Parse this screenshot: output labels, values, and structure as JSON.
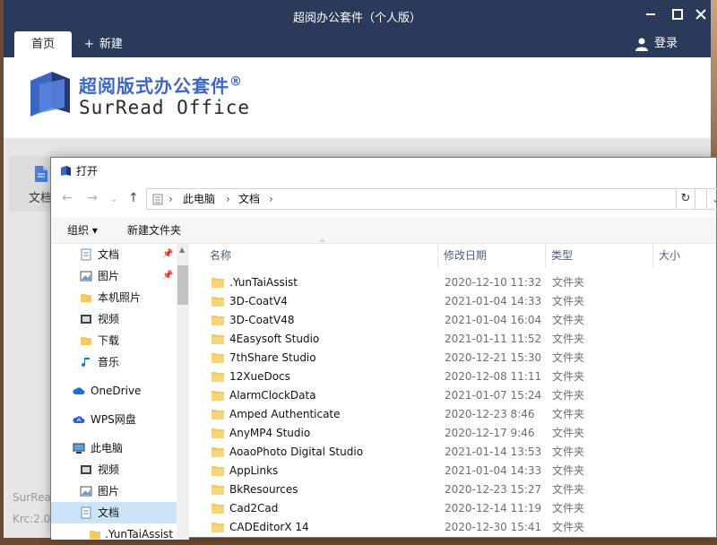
{
  "app": {
    "title": "超阅办公套件（个人版）",
    "tabs": {
      "home": "首页",
      "new": "新建"
    },
    "login": "登录",
    "brand_cn": "超阅版式办公套件",
    "brand_reg": "®",
    "brand_en": "SurRead  Office",
    "side_item": "文档",
    "footer_1": "SurRea",
    "footer_2": "Krc:2.0"
  },
  "window_controls": {
    "minimize": "✕",
    "restore": "—",
    "maximize": "☐",
    "close": "✕"
  },
  "dialog": {
    "title": "打开",
    "address": [
      "此电脑",
      "文档"
    ],
    "toolbar": {
      "organize": "组织 ▾",
      "new_folder": "新建文件夹"
    },
    "nav_items": [
      {
        "label": "文档",
        "icon": "document-icon",
        "pinned": true
      },
      {
        "label": "图片",
        "icon": "pictures-icon",
        "pinned": true
      },
      {
        "label": "本机照片",
        "icon": "folder-icon",
        "pinned": false
      },
      {
        "label": "视频",
        "icon": "video-icon",
        "pinned": false
      },
      {
        "label": "下载",
        "icon": "folder-icon",
        "pinned": false
      },
      {
        "label": "音乐",
        "icon": "music-icon",
        "pinned": false
      },
      {
        "label": "OneDrive",
        "icon": "cloud-icon",
        "pinned": false
      },
      {
        "label": "WPS网盘",
        "icon": "wps-cloud-icon",
        "pinned": false
      },
      {
        "label": "此电脑",
        "icon": "computer-icon",
        "pinned": false
      },
      {
        "label": "视频",
        "icon": "video-icon",
        "pinned": false
      },
      {
        "label": "图片",
        "icon": "pictures-icon",
        "pinned": false
      },
      {
        "label": "文档",
        "icon": "document-icon",
        "pinned": false
      },
      {
        "label": ".YunTaiAssist",
        "icon": "folder-icon",
        "pinned": false
      }
    ],
    "columns": {
      "name": "名称",
      "date": "修改日期",
      "type": "类型",
      "size": "大小"
    },
    "files": [
      {
        "name": ".YunTaiAssist",
        "date": "2020-12-10 11:32",
        "type": "文件夹"
      },
      {
        "name": "3D-CoatV4",
        "date": "2021-01-04 14:33",
        "type": "文件夹"
      },
      {
        "name": "3D-CoatV48",
        "date": "2021-01-04 16:04",
        "type": "文件夹"
      },
      {
        "name": "4Easysoft Studio",
        "date": "2021-01-11 11:52",
        "type": "文件夹"
      },
      {
        "name": "7thShare Studio",
        "date": "2020-12-21 15:30",
        "type": "文件夹"
      },
      {
        "name": "12XueDocs",
        "date": "2020-12-08 11:11",
        "type": "文件夹"
      },
      {
        "name": "AlarmClockData",
        "date": "2021-01-07 15:24",
        "type": "文件夹"
      },
      {
        "name": "Amped Authenticate",
        "date": "2020-12-23 8:46",
        "type": "文件夹"
      },
      {
        "name": "AnyMP4 Studio",
        "date": "2020-12-17 9:46",
        "type": "文件夹"
      },
      {
        "name": "AoaoPhoto Digital Studio",
        "date": "2021-01-14 13:53",
        "type": "文件夹"
      },
      {
        "name": "AppLinks",
        "date": "2021-01-04 14:33",
        "type": "文件夹"
      },
      {
        "name": "BkResources",
        "date": "2020-12-23 15:27",
        "type": "文件夹"
      },
      {
        "name": "Cad2Cad",
        "date": "2020-12-14 11:19",
        "type": "文件夹"
      },
      {
        "name": "CADEditorX 14",
        "date": "2020-12-30 15:41",
        "type": "文件夹"
      }
    ]
  },
  "colors": {
    "titlebar": "#2b3a5a",
    "brand_blue": "#3b66c4",
    "folder_yellow": "#f4c95d",
    "selection": "#cce4f7"
  }
}
